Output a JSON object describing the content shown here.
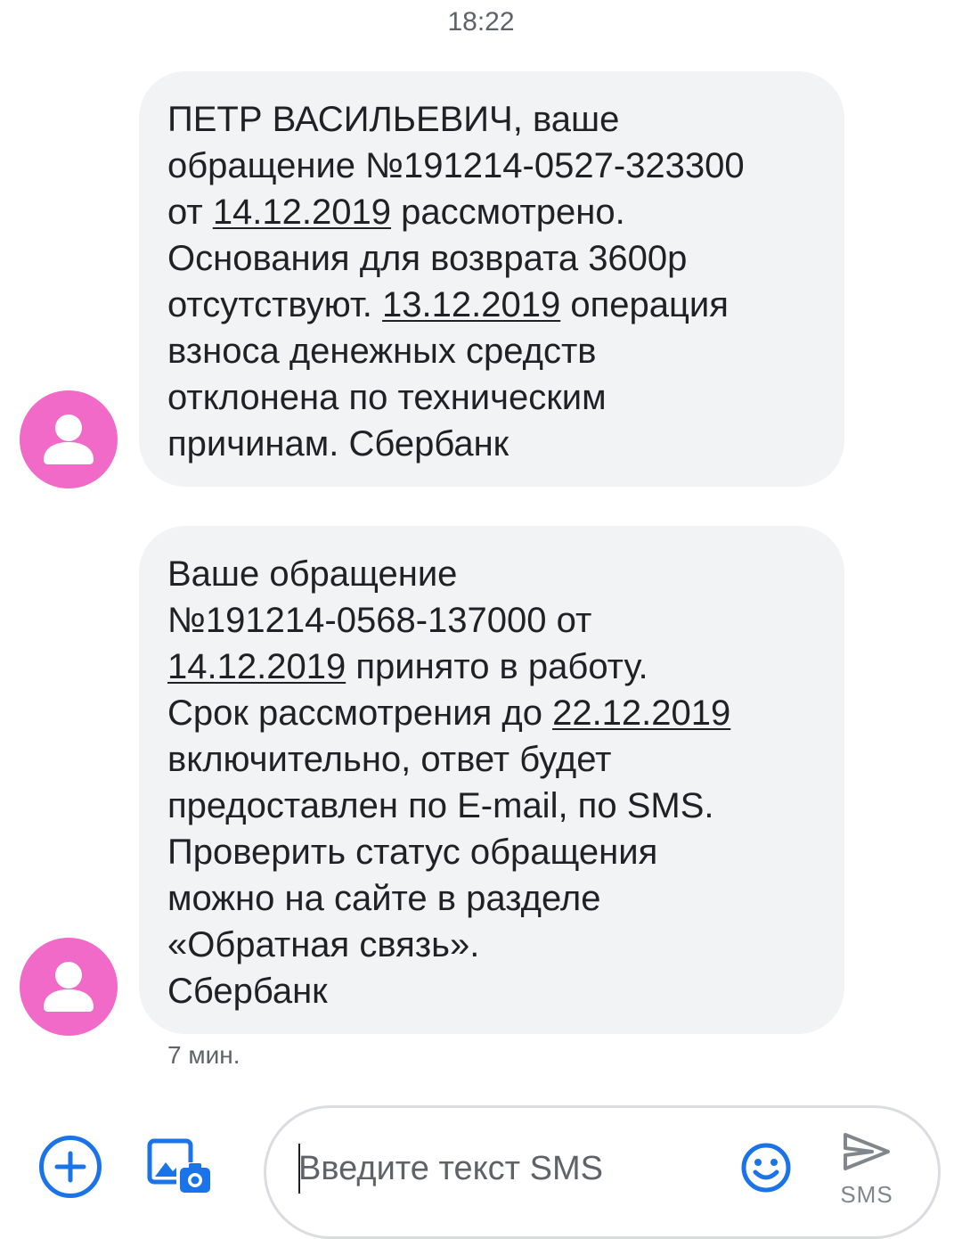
{
  "conversation": {
    "timestamp": "18:22",
    "messages": [
      {
        "lines": [
          {
            "segments": [
              {
                "text": "ПЕТР ВАСИЛЬЕВИЧ, ваше",
                "link": false
              }
            ]
          },
          {
            "segments": [
              {
                "text": "обращение №191214-0527-323300",
                "link": false
              }
            ]
          },
          {
            "segments": [
              {
                "text": "от ",
                "link": false
              },
              {
                "text": "14.12.2019",
                "link": true
              },
              {
                "text": " рассмотрено.",
                "link": false
              }
            ]
          },
          {
            "segments": [
              {
                "text": "Основания для возврата 3600р",
                "link": false
              }
            ]
          },
          {
            "segments": [
              {
                "text": "отсутствуют. ",
                "link": false
              },
              {
                "text": "13.12.2019",
                "link": true
              },
              {
                "text": " операция",
                "link": false
              }
            ]
          },
          {
            "segments": [
              {
                "text": "взноса денежных средств",
                "link": false
              }
            ]
          },
          {
            "segments": [
              {
                "text": "отклонена по техническим",
                "link": false
              }
            ]
          },
          {
            "segments": [
              {
                "text": "причинам. Сбербанк",
                "link": false
              }
            ]
          }
        ]
      },
      {
        "lines": [
          {
            "segments": [
              {
                "text": "Ваше обращение",
                "link": false
              }
            ]
          },
          {
            "segments": [
              {
                "text": "№191214-0568-137000 от",
                "link": false
              }
            ]
          },
          {
            "segments": [
              {
                "text": "14.12.2019",
                "link": true
              },
              {
                "text": " принято в работу.",
                "link": false
              }
            ]
          },
          {
            "segments": [
              {
                "text": "Срок рассмотрения до ",
                "link": false
              },
              {
                "text": "22.12.2019",
                "link": true
              }
            ]
          },
          {
            "segments": [
              {
                "text": "включительно, ответ будет",
                "link": false
              }
            ]
          },
          {
            "segments": [
              {
                "text": "предоставлен по E-mail, по SMS.",
                "link": false
              }
            ]
          },
          {
            "segments": [
              {
                "text": "Проверить статус обращения",
                "link": false
              }
            ]
          },
          {
            "segments": [
              {
                "text": "можно на сайте в разделе",
                "link": false
              }
            ]
          },
          {
            "segments": [
              {
                "text": "«Обратная связь».",
                "link": false
              }
            ]
          },
          {
            "segments": [
              {
                "text": "Сбербанк",
                "link": false
              }
            ]
          }
        ]
      }
    ],
    "last_message_time": "7 мин."
  },
  "compose": {
    "placeholder": "Введите текст SMS",
    "value": "",
    "send_label": "SMS"
  },
  "icons": {
    "avatar": "person-icon",
    "add": "add-circle-icon",
    "gallery": "add-photo-icon",
    "emoji": "emoji-icon",
    "send": "send-icon"
  },
  "colors": {
    "avatar_bg": "#f26ac8",
    "accent": "#1a73e8",
    "bubble_bg": "#f1f3f4",
    "send_disabled": "#80868b"
  }
}
